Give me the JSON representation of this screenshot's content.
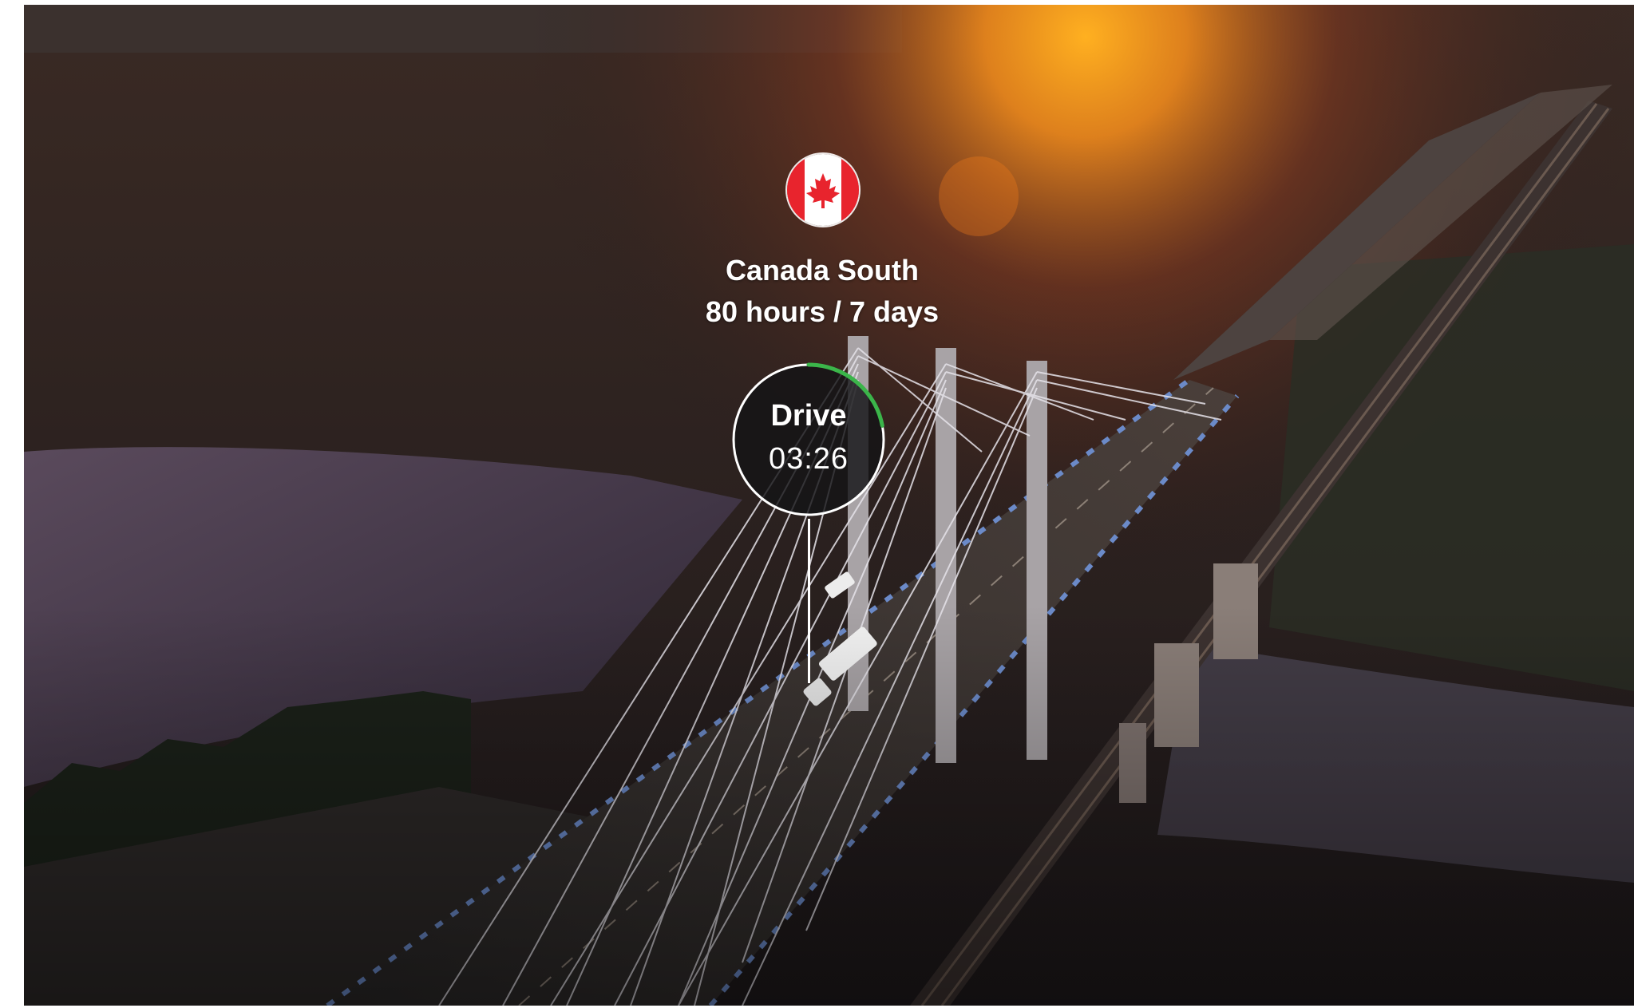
{
  "hos_overlay": {
    "region_name": "Canada South",
    "cycle_rule": "80 hours / 7 days",
    "flag_icon": "canada-flag-icon",
    "duty_status": "Drive",
    "time_remaining": "03:26",
    "drive_progress_fraction": 0.22,
    "progress_color": "#3bb54a"
  }
}
